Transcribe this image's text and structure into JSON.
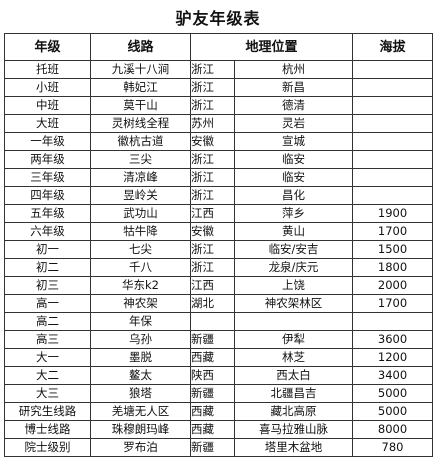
{
  "title": "驴友年级表",
  "headers": {
    "grade": "年级",
    "route": "线路",
    "location": "地理位置",
    "altitude": "海拔"
  },
  "rows": [
    {
      "grade": "托班",
      "route": "九溪十八涧",
      "province": "浙江",
      "place": "杭州",
      "altitude": ""
    },
    {
      "grade": "小班",
      "route": "韩妃江",
      "province": "浙江",
      "place": "新昌",
      "altitude": ""
    },
    {
      "grade": "中班",
      "route": "莫干山",
      "province": "浙江",
      "place": "德清",
      "altitude": ""
    },
    {
      "grade": "大班",
      "route": "灵树线全程",
      "province": "苏州",
      "place": "灵岩",
      "altitude": ""
    },
    {
      "grade": "一年级",
      "route": "徽杭古道",
      "province": "安徽",
      "place": "宣城",
      "altitude": ""
    },
    {
      "grade": "两年级",
      "route": "三尖",
      "province": "浙江",
      "place": "临安",
      "altitude": ""
    },
    {
      "grade": "三年级",
      "route": "清凉峰",
      "province": "浙江",
      "place": "临安",
      "altitude": ""
    },
    {
      "grade": "四年级",
      "route": "昱岭关",
      "province": "浙江",
      "place": "昌化",
      "altitude": ""
    },
    {
      "grade": "五年级",
      "route": "武功山",
      "province": "江西",
      "place": "萍乡",
      "altitude": "1900"
    },
    {
      "grade": "六年级",
      "route": "牯牛降",
      "province": "安徽",
      "place": "黄山",
      "altitude": "1700"
    },
    {
      "grade": "初一",
      "route": "七尖",
      "province": "浙江",
      "place": "临安/安吉",
      "altitude": "1500"
    },
    {
      "grade": "初二",
      "route": "千八",
      "province": "浙江",
      "place": "龙泉/庆元",
      "altitude": "1800"
    },
    {
      "grade": "初三",
      "route": "华东k2",
      "province": "江西",
      "place": "上饶",
      "altitude": "2000"
    },
    {
      "grade": "高一",
      "route": "神农架",
      "province": "湖北",
      "place": "神农架林区",
      "altitude": "1700"
    },
    {
      "grade": "高二",
      "route": "年保",
      "province": "",
      "place": "",
      "altitude": ""
    },
    {
      "grade": "高三",
      "route": "乌孙",
      "province": "新疆",
      "place": "伊犁",
      "altitude": "3600"
    },
    {
      "grade": "大一",
      "route": "墨脱",
      "province": "西藏",
      "place": "林芝",
      "altitude": "1200"
    },
    {
      "grade": "大二",
      "route": "鳌太",
      "province": "陕西",
      "place": "西太白",
      "altitude": "3400"
    },
    {
      "grade": "大三",
      "route": "狼塔",
      "province": "新疆",
      "place": "北疆昌吉",
      "altitude": "5000"
    },
    {
      "grade": "研究生线路",
      "route": "羌塘无人区",
      "province": "西藏",
      "place": "藏北高原",
      "altitude": "5000"
    },
    {
      "grade": "博士线路",
      "route": "珠穆朗玛峰",
      "province": "西藏",
      "place": "喜马拉雅山脉",
      "altitude": "8000"
    },
    {
      "grade": "院士级别",
      "route": "罗布泊",
      "province": "新疆",
      "place": "塔里木盆地",
      "altitude": "780"
    }
  ]
}
